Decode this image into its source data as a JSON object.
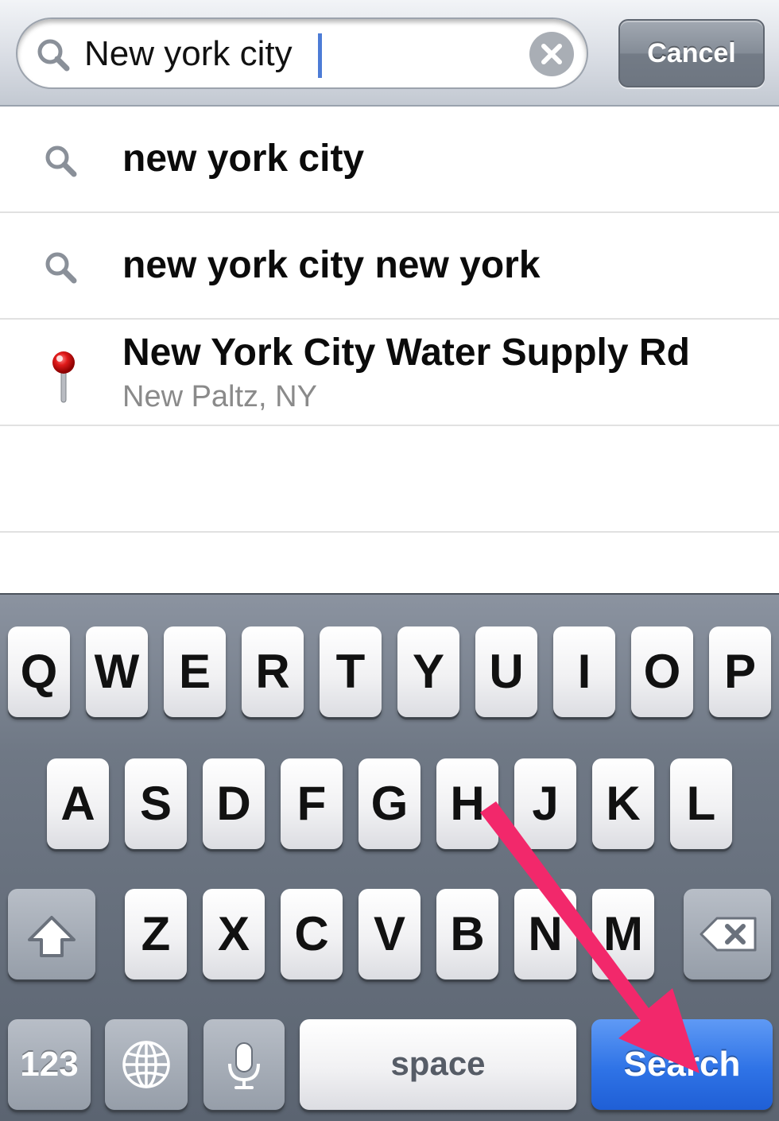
{
  "search": {
    "value": "New york city",
    "cancel_label": "Cancel",
    "icon": "search-icon",
    "clear_icon": "clear-icon"
  },
  "results": [
    {
      "type": "query",
      "icon": "search-icon",
      "title": "new york city"
    },
    {
      "type": "query",
      "icon": "search-icon",
      "title": "new york city new york"
    },
    {
      "type": "place",
      "icon": "map-pin-icon",
      "title": "New York City Water Supply Rd",
      "subtitle": "New Paltz, NY"
    }
  ],
  "keyboard": {
    "row1": [
      "Q",
      "W",
      "E",
      "R",
      "T",
      "Y",
      "U",
      "I",
      "O",
      "P"
    ],
    "row2": [
      "A",
      "S",
      "D",
      "F",
      "G",
      "H",
      "J",
      "K",
      "L"
    ],
    "row3": [
      "Z",
      "X",
      "C",
      "V",
      "B",
      "N",
      "M"
    ],
    "numbers_label": "123",
    "space_label": "space",
    "search_label": "Search",
    "shift_icon": "shift-icon",
    "backspace_icon": "backspace-icon",
    "globe_icon": "globe-icon",
    "microphone_icon": "microphone-icon"
  },
  "annotation": {
    "arrow_color": "#f2286b",
    "icon": "arrow-annotation"
  },
  "colors": {
    "search_key": "#2f73e6",
    "keyboard_bg": "#6f7885"
  }
}
